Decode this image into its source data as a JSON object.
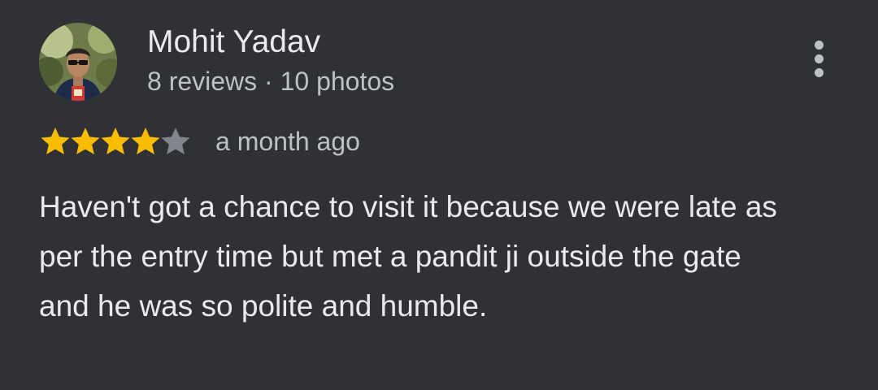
{
  "review": {
    "author_name": "Mohit Yadav",
    "author_meta": "8 reviews · 10 photos",
    "avatar_icon": "user-avatar-photo",
    "more_icon": "more-vert-icon",
    "rating": 4,
    "rating_max": 5,
    "date": "a month ago",
    "text": "Haven't got a chance to visit it because we were late as per the entry time but met a pandit ji outside the gate and he was so polite and humble."
  },
  "colors": {
    "background": "#303134",
    "text_primary": "#e8eaed",
    "text_secondary": "#bdc1c6",
    "star_filled": "#fbbc04",
    "star_empty": "#80868b"
  }
}
